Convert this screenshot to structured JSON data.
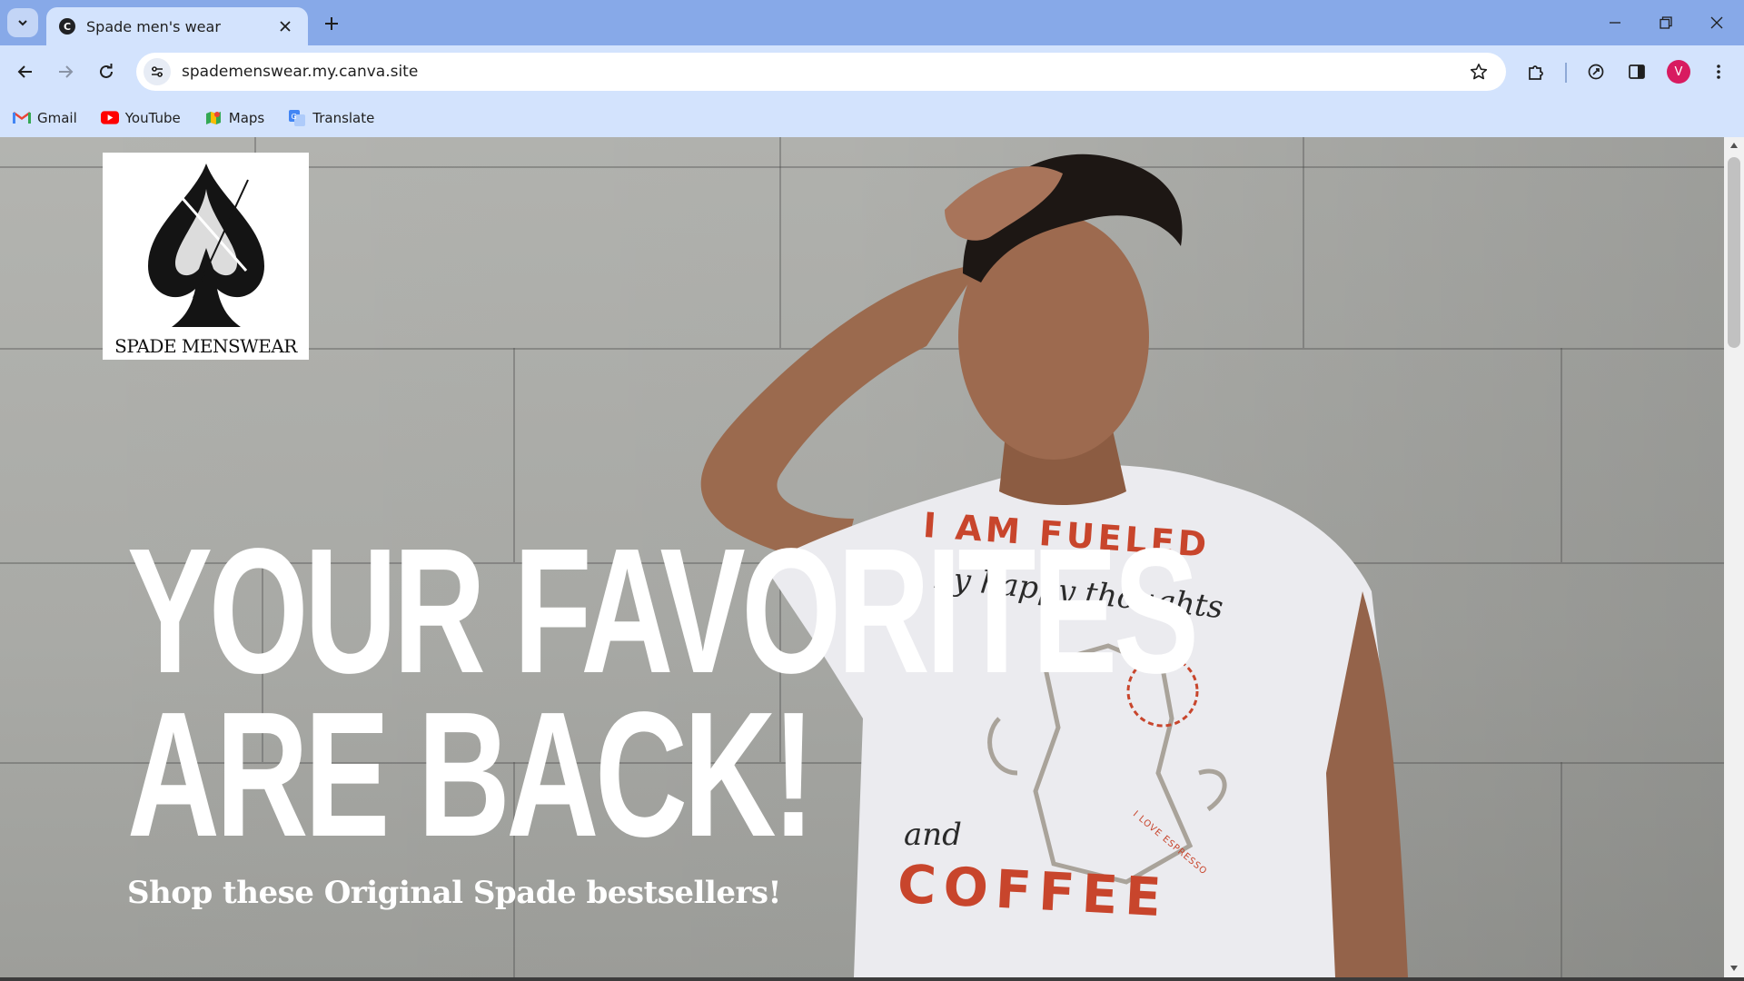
{
  "browser": {
    "tab_title": "Spade men's wear",
    "tab_favicon_letter": "C",
    "url": "spademenswear.my.canva.site",
    "profile_initial": "V",
    "profile_color": "#d81b60",
    "bookmarks": [
      {
        "label": "Gmail",
        "icon": "gmail-icon"
      },
      {
        "label": "YouTube",
        "icon": "youtube-icon"
      },
      {
        "label": "Maps",
        "icon": "maps-icon"
      },
      {
        "label": "Translate",
        "icon": "translate-icon"
      }
    ]
  },
  "page": {
    "logo": {
      "text": "SPADE MENSWEAR",
      "icon": "spade-icon"
    },
    "headline_line1": "YOUR FAVORITES",
    "headline_line2": "ARE BACK!",
    "subheadline": "Shop these Original Spade bestsellers!",
    "tshirt_print": {
      "line1": "I AM FUELED",
      "line2": "by happy thoughts",
      "ring_text": "I LOVE ESPRESSO",
      "line3": "and",
      "line4": "COFFEE"
    }
  },
  "colors": {
    "titlebar": "#87a9e8",
    "toolbar": "#d3e3fd",
    "print_red": "#c8452c"
  }
}
